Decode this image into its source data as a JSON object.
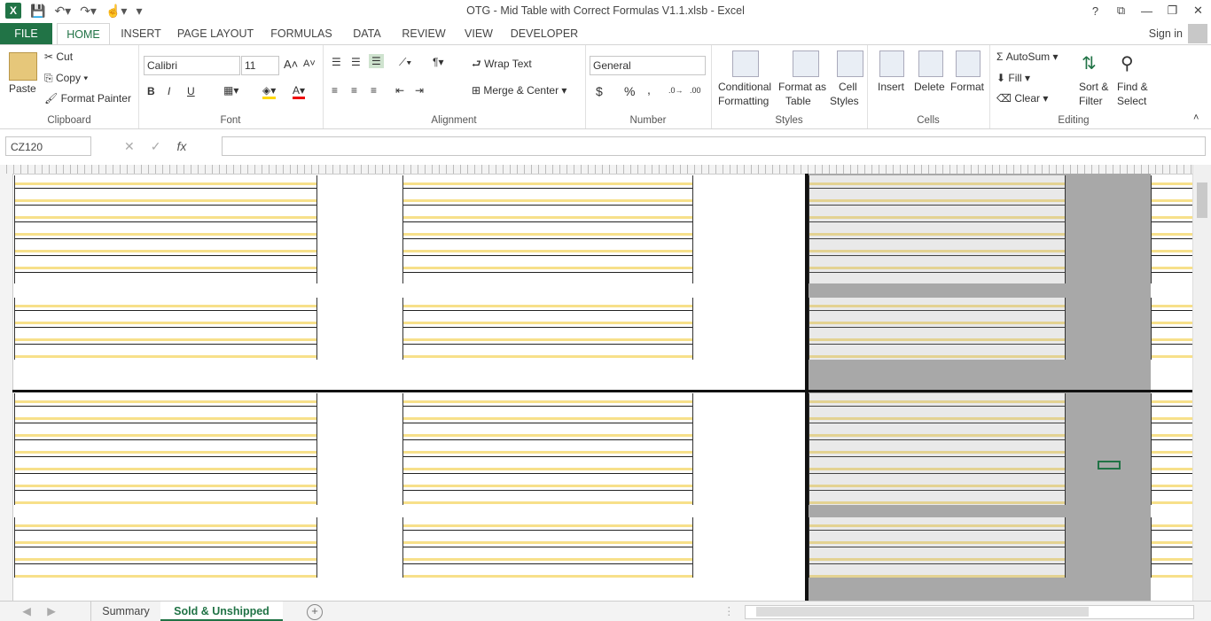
{
  "window": {
    "title": "OTG - Mid Table with Correct Formulas V1.1.xlsb - Excel",
    "controls": [
      "?",
      "⧉",
      "—",
      "❐",
      "✕"
    ]
  },
  "qat": {
    "logo": "X",
    "save_icon": "save-icon",
    "undo_icon": "undo-icon",
    "redo_icon": "redo-icon",
    "touch_icon": "touch-mode-icon"
  },
  "tabs": [
    "FILE",
    "HOME",
    "INSERT",
    "PAGE LAYOUT",
    "FORMULAS",
    "DATA",
    "REVIEW",
    "VIEW",
    "DEVELOPER"
  ],
  "account": {
    "signin": "Sign in"
  },
  "ribbon": {
    "clipboard": {
      "paste": "Paste",
      "cut": "Cut",
      "copy": "Copy",
      "format_painter": "Format Painter",
      "name": "Clipboard"
    },
    "font": {
      "family": "Calibri",
      "size": "11",
      "bold": "B",
      "italic": "I",
      "underline": "U",
      "name": "Font"
    },
    "alignment": {
      "wrap": "Wrap Text",
      "merge": "Merge & Center",
      "name": "Alignment"
    },
    "number": {
      "format": "General",
      "currency": "$",
      "percent": "%",
      "comma": ",",
      "name": "Number"
    },
    "styles": {
      "conditional_line1": "Conditional",
      "conditional_line2": "Formatting",
      "table_line1": "Format as",
      "table_line2": "Table",
      "cell_line1": "Cell",
      "cell_line2": "Styles",
      "name": "Styles"
    },
    "cells": {
      "insert": "Insert",
      "delete": "Delete",
      "format": "Format",
      "name": "Cells"
    },
    "editing": {
      "autosum": "AutoSum",
      "fill": "Fill",
      "clear": "Clear",
      "sort_line1": "Sort &",
      "sort_line2": "Filter",
      "find_line1": "Find &",
      "find_line2": "Select",
      "name": "Editing"
    }
  },
  "formula_bar": {
    "name_box": "CZ120",
    "cancel": "✕",
    "enter": "✓",
    "fx": "fx",
    "value": ""
  },
  "sheets": {
    "tabs": [
      "Summary",
      "Sold & Unshipped"
    ],
    "active": "Sold & Unshipped",
    "add": "+"
  },
  "colors": {
    "accent": "#217346",
    "stripe": "#f7e08a",
    "shade": "#a8a8a8"
  }
}
